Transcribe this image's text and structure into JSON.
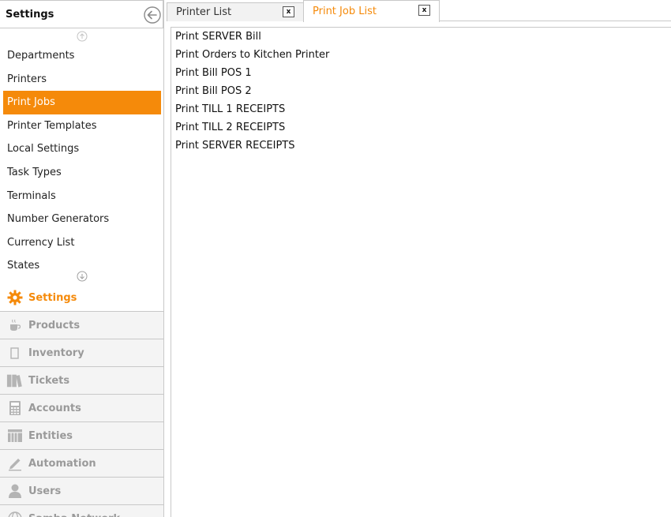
{
  "sidebar": {
    "title": "Settings",
    "items": [
      {
        "label": "Departments"
      },
      {
        "label": "Printers"
      },
      {
        "label": "Print Jobs"
      },
      {
        "label": "Printer Templates"
      },
      {
        "label": "Local Settings"
      },
      {
        "label": "Task Types"
      },
      {
        "label": "Terminals"
      },
      {
        "label": "Number Generators"
      },
      {
        "label": "Currency List"
      },
      {
        "label": "States"
      }
    ],
    "selected_item": "Print Jobs",
    "sections": [
      {
        "label": "Settings",
        "icon": "gear-icon"
      },
      {
        "label": "Products",
        "icon": "coffee-cup-icon"
      },
      {
        "label": "Inventory",
        "icon": "box-icon"
      },
      {
        "label": "Tickets",
        "icon": "books-icon"
      },
      {
        "label": "Accounts",
        "icon": "calculator-icon"
      },
      {
        "label": "Entities",
        "icon": "grid-icon"
      },
      {
        "label": "Automation",
        "icon": "pencil-icon"
      },
      {
        "label": "Users",
        "icon": "user-icon"
      },
      {
        "label": "Samba Network",
        "icon": "globe-icon"
      }
    ],
    "selected_section": "Settings"
  },
  "tabs": [
    {
      "label": "Printer List",
      "close_label": "x"
    },
    {
      "label": "Print Job List",
      "close_label": "x"
    }
  ],
  "active_tab": "Print Job List",
  "print_jobs": [
    "Print SERVER Bill",
    "Print Orders to Kitchen Printer",
    "Print Bill POS 1",
    "Print Bill POS 2",
    "Print TILL 1 RECEIPTS",
    "Print TILL 2 RECEIPTS",
    "Print SERVER RECEIPTS"
  ],
  "colors": {
    "accent": "#f58a0a",
    "border": "#c8c8c8",
    "muted": "#9a9a9a"
  }
}
